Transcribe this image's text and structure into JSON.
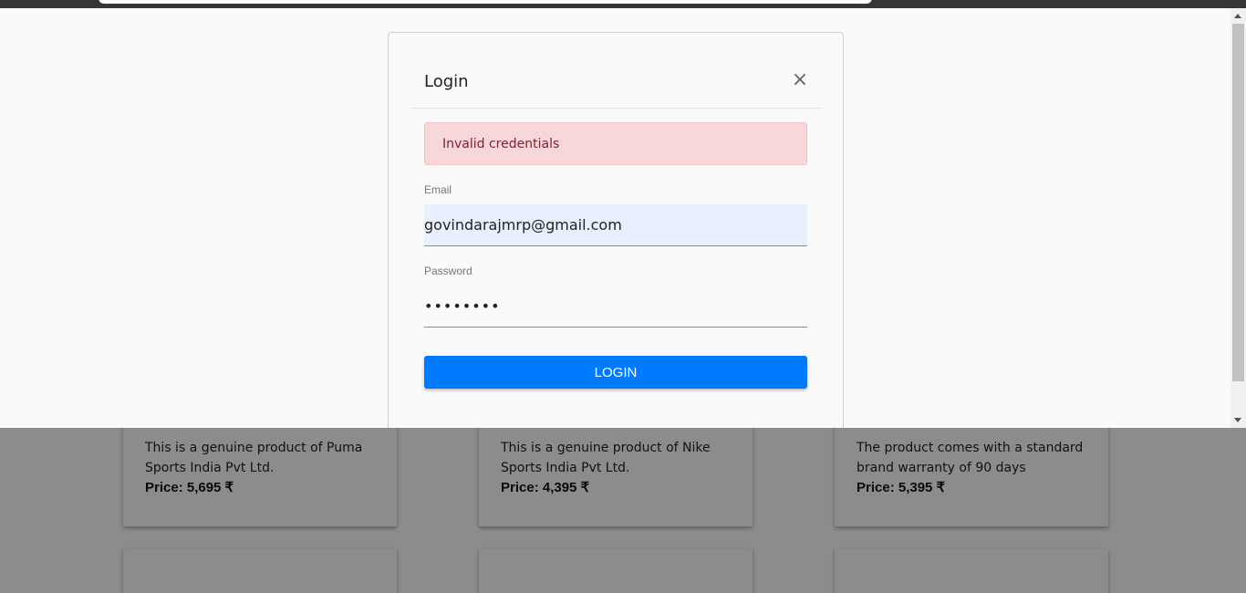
{
  "dialog": {
    "title": "Login",
    "close_symbol": "×",
    "alert_text": "Invalid credentials",
    "email_label": "Email",
    "email_value": "govindarajmrp@gmail.com",
    "password_label": "Password",
    "password_value": "••••••••",
    "login_button": "LOGIN"
  },
  "products": [
    {
      "description": "This is a genuine product of Puma Sports India Pvt Ltd.",
      "price": "Price: 5,695 ₹"
    },
    {
      "description": "This is a genuine product of Nike Sports India Pvt Ltd.",
      "price": "Price: 4,395 ₹"
    },
    {
      "description": "The product comes with a standard brand warranty of 90 days",
      "price": "Price: 5,395 ₹"
    }
  ],
  "colors": {
    "accent": "#007bff",
    "alert_bg": "#f8d7da",
    "alert_text": "#842029",
    "autofill_bg": "#e8f0fe",
    "fab": "#c62828"
  },
  "icons": {
    "close": "close-icon",
    "favorite": "favorite-fab-icon"
  }
}
